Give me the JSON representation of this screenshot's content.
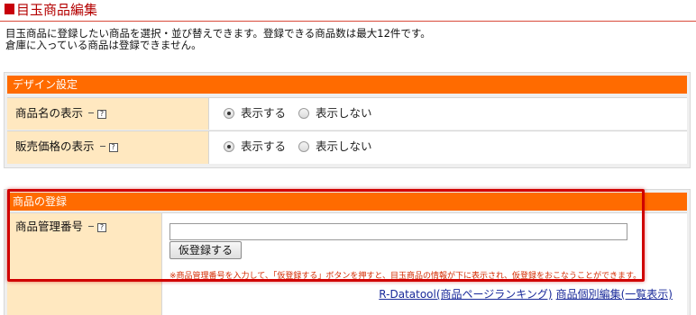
{
  "page": {
    "title": "目玉商品編集",
    "description_lines": [
      "目玉商品に登録したい商品を選択・並び替えできます。登録できる商品数は最大12件です。",
      "倉庫に入っている商品は登録できません。"
    ]
  },
  "design_settings": {
    "header": "デザイン設定",
    "rows": [
      {
        "label": "商品名の表示",
        "help": "?",
        "option_show": "表示する",
        "option_hide": "表示しない",
        "selected": "show"
      },
      {
        "label": "販売価格の表示",
        "help": "?",
        "option_show": "表示する",
        "option_hide": "表示しない",
        "selected": "show"
      }
    ]
  },
  "product_registration": {
    "header": "商品の登録",
    "label": "商品管理番号",
    "help": "?",
    "input_value": "",
    "button_label": "仮登録する",
    "note": "※商品管理番号を入力して、「仮登録する」ボタンを押すと、目玉商品の情報が下に表示され、仮登録をおこなうことができます。",
    "link_ranking": "R-Datatool(商品ページランキング)",
    "link_edit": "商品個別編集(一覧表示)"
  },
  "colors": {
    "accent_orange": "#ff6b00",
    "title_red": "#b40000",
    "label_bg": "#ffe8c0",
    "highlight_red": "#d00000"
  }
}
